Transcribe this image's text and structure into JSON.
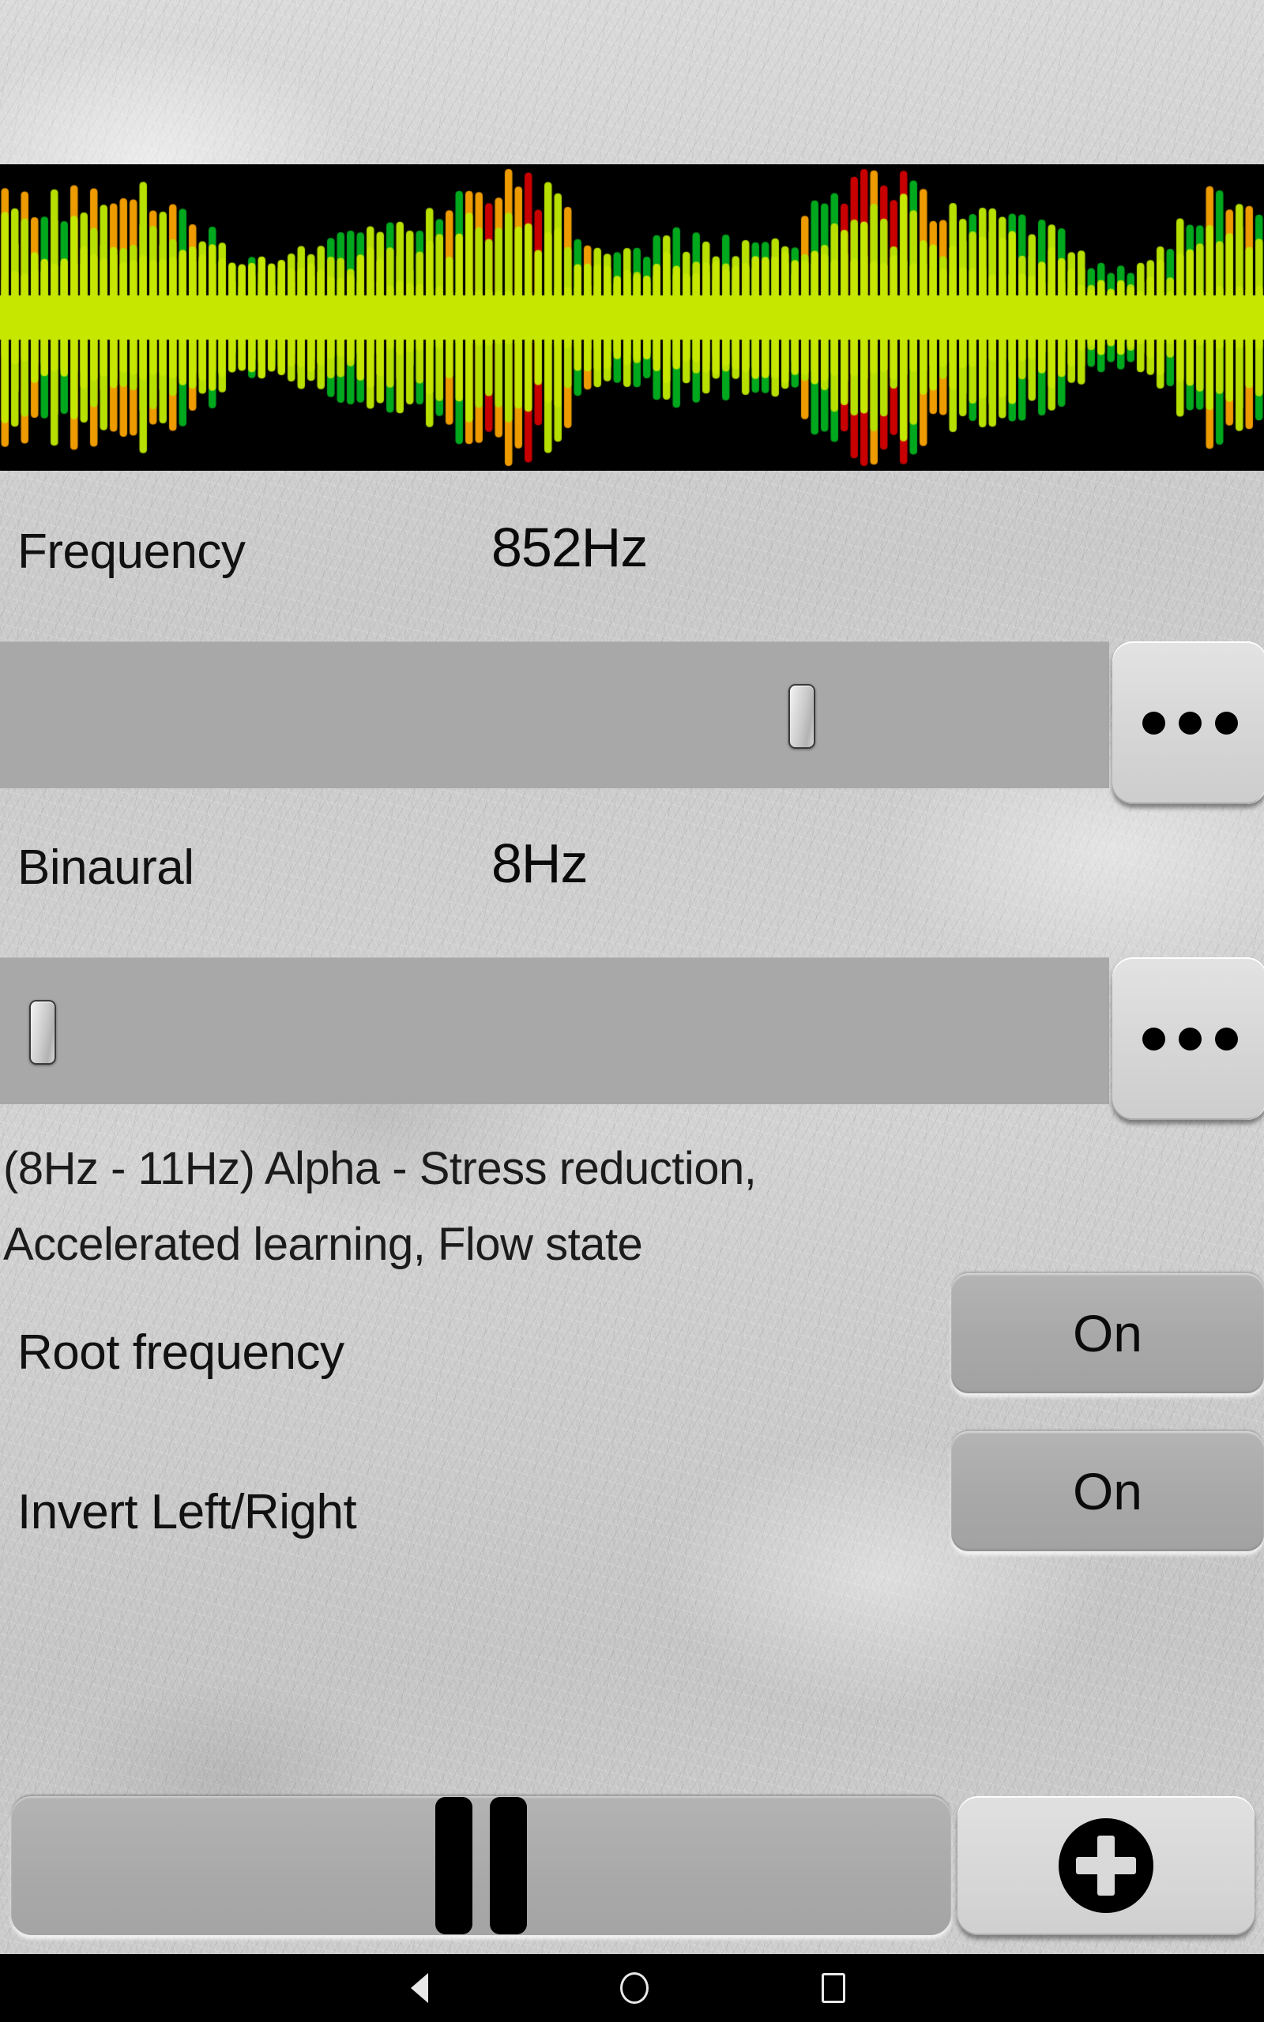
{
  "app": {
    "background_color": "#c9c9c9",
    "accent_color": "#a8a8a8"
  },
  "visualizer": {
    "name": "audio-waveform-visualizer",
    "background_color": "#000000",
    "colors": {
      "green": "#00a81e",
      "yellow_green": "#b7e000",
      "lime": "#c6e800",
      "orange": "#ee9b00",
      "red": "#c80000"
    },
    "bar_count": 128
  },
  "frequency": {
    "label": "Frequency",
    "value": "852Hz",
    "slider": {
      "position_percent": 73,
      "min_percent": 0,
      "max_percent": 100
    },
    "more_button_label": "…"
  },
  "binaural": {
    "label": "Binaural",
    "value": "8Hz",
    "slider": {
      "position_percent": 2,
      "min_percent": 0,
      "max_percent": 100
    },
    "more_button_label": "…"
  },
  "description": {
    "line1": "(8Hz - 11Hz) Alpha - Stress reduction,",
    "line2": "Accelerated learning, Flow state"
  },
  "settings": [
    {
      "label": "Root frequency",
      "value": "On"
    },
    {
      "label": "Invert Left/Right",
      "value": "On"
    }
  ],
  "transport": {
    "pause_label": "Pause",
    "add_label": "Add"
  },
  "navbar": {
    "back_label": "Back",
    "home_label": "Home",
    "recents_label": "Recents"
  }
}
